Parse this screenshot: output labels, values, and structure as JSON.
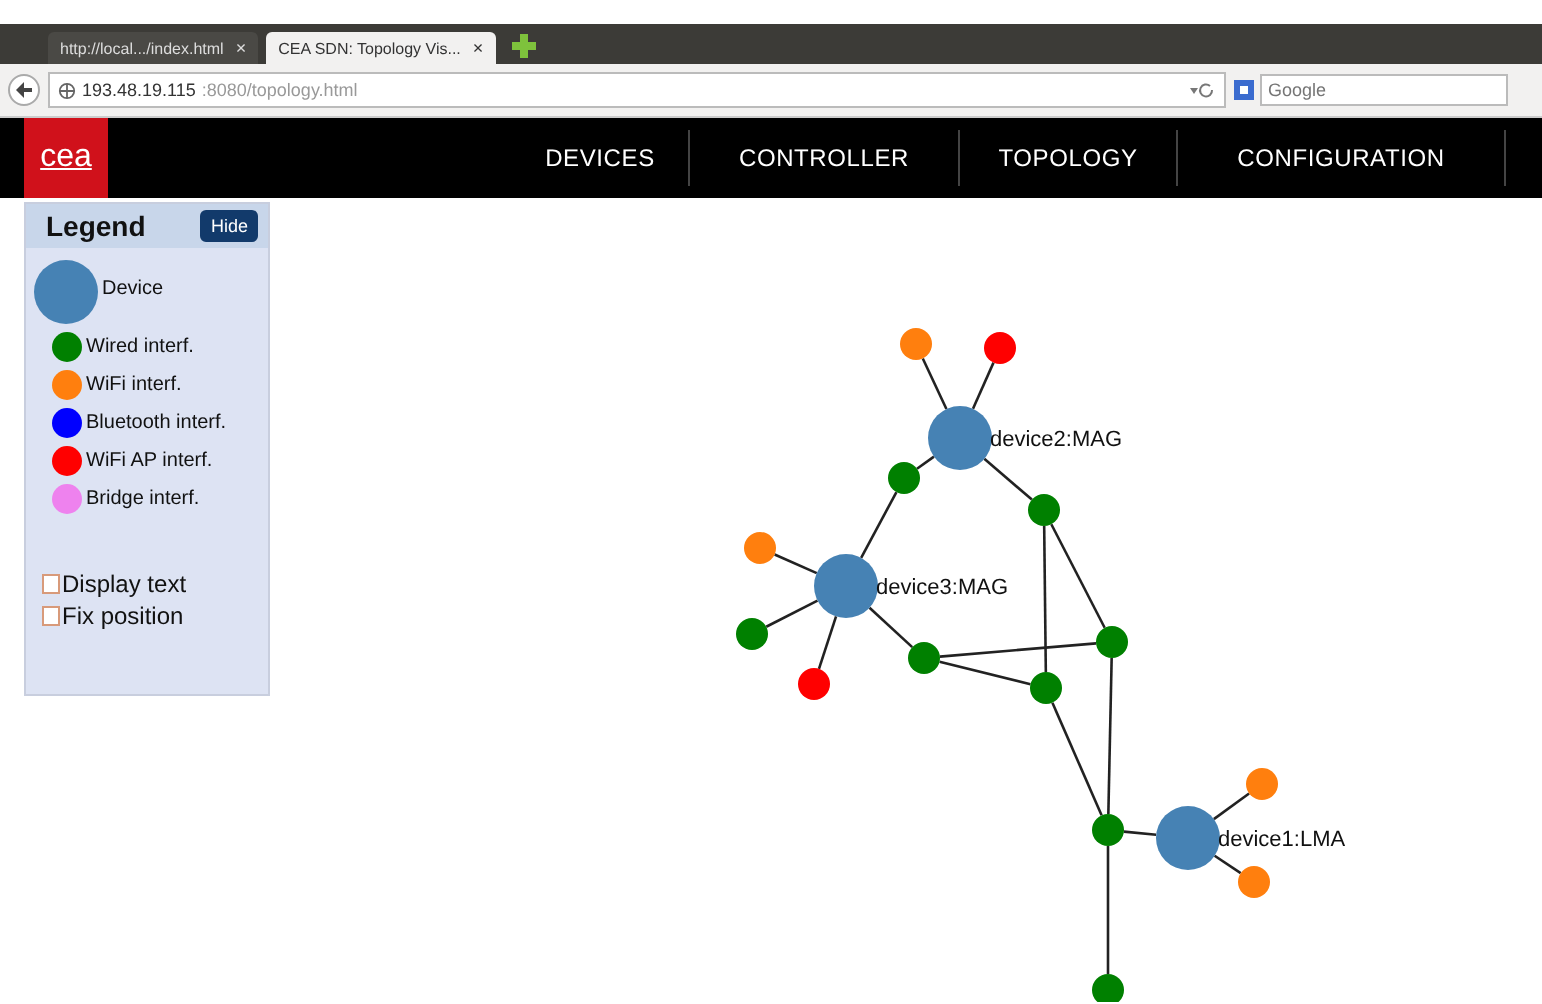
{
  "browser": {
    "tabs": [
      {
        "title": "http://local.../index.html",
        "selected": false
      },
      {
        "title": "CEA SDN: Topology Vis...",
        "selected": true
      }
    ],
    "close": "×",
    "url_host": "193.48.19.115",
    "url_path": ":8080/topology.html",
    "search": {
      "placeholder": "Google"
    }
  },
  "nav": {
    "logo": "cea",
    "items": [
      {
        "label": "DEVICES"
      },
      {
        "label": "CONTROLLER"
      },
      {
        "label": "TOPOLOGY"
      },
      {
        "label": "CONFIGURATION"
      }
    ]
  },
  "legend": {
    "title": "Legend",
    "hide_button": "Hide",
    "items": [
      {
        "kind": "device",
        "label": "Device",
        "color": "#4682b4"
      },
      {
        "kind": "interface",
        "label": "Wired interf.",
        "color": "#008000"
      },
      {
        "kind": "interface",
        "label": "WiFi interf.",
        "color": "#ff7f0e"
      },
      {
        "kind": "interface",
        "label": "Bluetooth interf.",
        "color": "#0000ff"
      },
      {
        "kind": "interface",
        "label": "WiFi AP interf.",
        "color": "#ff0000"
      },
      {
        "kind": "interface",
        "label": "Bridge interf.",
        "color": "#ee82ee"
      }
    ],
    "options": [
      {
        "label": "Display text",
        "checked": false
      },
      {
        "label": "Fix position",
        "checked": false
      }
    ]
  },
  "graph": {
    "nodes": [
      {
        "kind": "device",
        "label": "device2:MAG",
        "color": "#4682b4"
      },
      {
        "kind": "interface",
        "color": "#ff7f0e"
      },
      {
        "kind": "interface",
        "color": "#ff0000"
      },
      {
        "kind": "interface",
        "color": "#008000"
      },
      {
        "kind": "interface",
        "color": "#008000"
      },
      {
        "kind": "device",
        "label": "device3:MAG",
        "color": "#4682b4"
      },
      {
        "kind": "interface",
        "color": "#ff7f0e"
      },
      {
        "kind": "interface",
        "color": "#008000"
      },
      {
        "kind": "interface",
        "color": "#ff0000"
      },
      {
        "kind": "interface",
        "color": "#008000"
      },
      {
        "kind": "interface",
        "color": "#008000"
      },
      {
        "kind": "interface",
        "color": "#008000"
      },
      {
        "kind": "interface",
        "color": "#008000"
      },
      {
        "kind": "device",
        "label": "device1:LMA",
        "color": "#4682b4"
      },
      {
        "kind": "interface",
        "color": "#ff7f0e"
      },
      {
        "kind": "interface",
        "color": "#ff7f0e"
      },
      {
        "kind": "interface",
        "color": "#008000"
      }
    ]
  }
}
